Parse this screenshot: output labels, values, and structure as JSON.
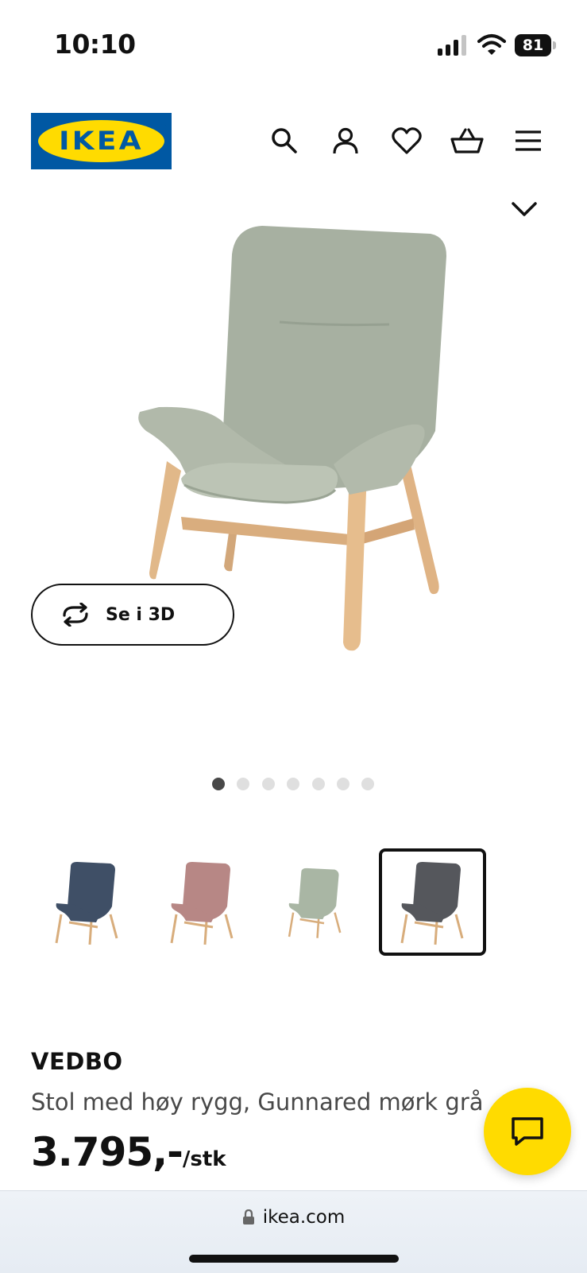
{
  "status_bar": {
    "time": "10:10",
    "battery": "81"
  },
  "header": {
    "logo_text": "IKEA",
    "icons": [
      "search-icon",
      "user-icon",
      "heart-icon",
      "basket-icon",
      "menu-icon"
    ]
  },
  "gallery": {
    "view_3d_label": "Se i 3D",
    "dots_total": 7,
    "active_dot": 1
  },
  "variants": [
    {
      "color_name": "blue",
      "seat_color": "#3f4f66",
      "selected": false
    },
    {
      "color_name": "pink",
      "seat_color": "#b78785",
      "selected": false
    },
    {
      "color_name": "light green",
      "seat_color": "#a9b6a4",
      "selected": false
    },
    {
      "color_name": "dark grey",
      "seat_color": "#55575c",
      "selected": true
    }
  ],
  "product": {
    "name": "VEDBO",
    "description": "Stol med høy rygg, Gunnared mørk grå",
    "price": "3.795,-",
    "price_unit": "/stk"
  },
  "browser": {
    "url": "ikea.com"
  },
  "colors": {
    "ikea_blue": "#0058a3",
    "ikea_yellow": "#ffdb00"
  }
}
